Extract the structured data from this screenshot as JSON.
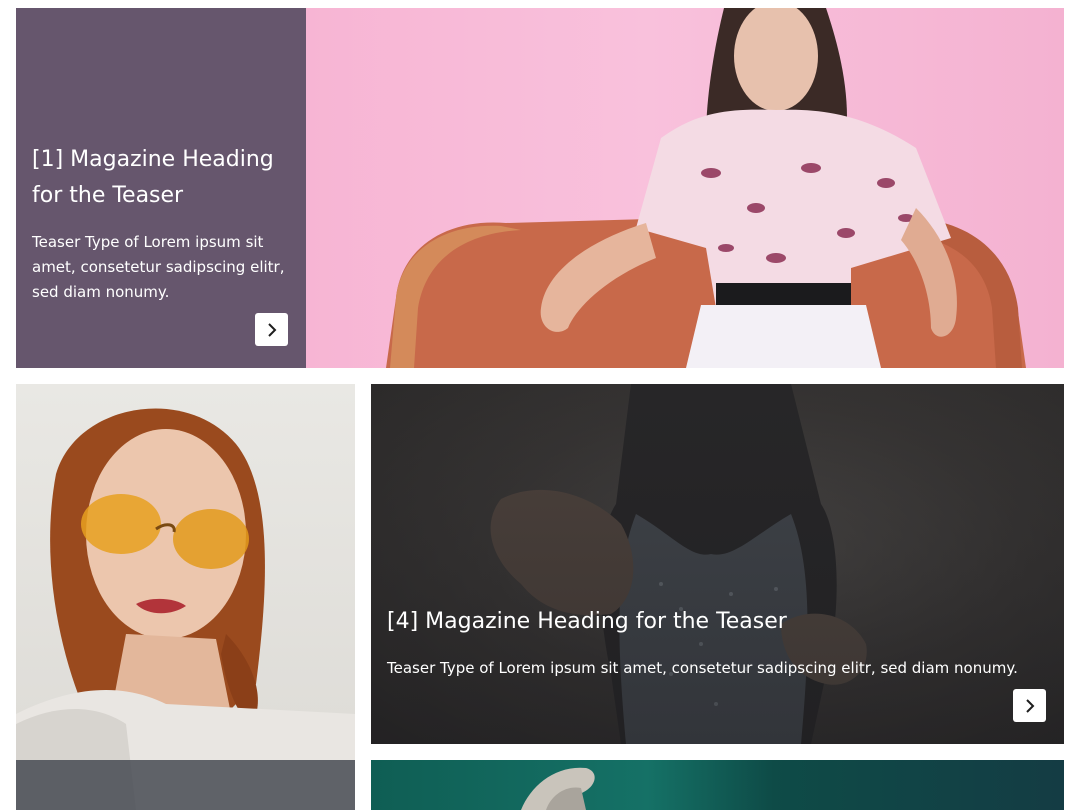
{
  "teasers": [
    {
      "heading": "[1] Magazine Heading for the Teaser",
      "text": "Teaser Type of Lorem ipsum sit amet, consetetur sadipscing elitr, sed diam nonumy.",
      "button_icon": "chevron-right-icon"
    },
    {
      "heading": "[4] Magazine Heading for the Teaser",
      "text": "Teaser Type of Lorem ipsum sit amet, consetetur sadipscing elitr, sed diam nonumy.",
      "button_icon": "chevron-right-icon"
    }
  ],
  "colors": {
    "panel": "#605268",
    "tile1_background": "#f6b9d6",
    "tile4_background": "#3f3c3a",
    "tile5_background": "#157166",
    "button": "#ffffff",
    "text": "#ffffff"
  }
}
